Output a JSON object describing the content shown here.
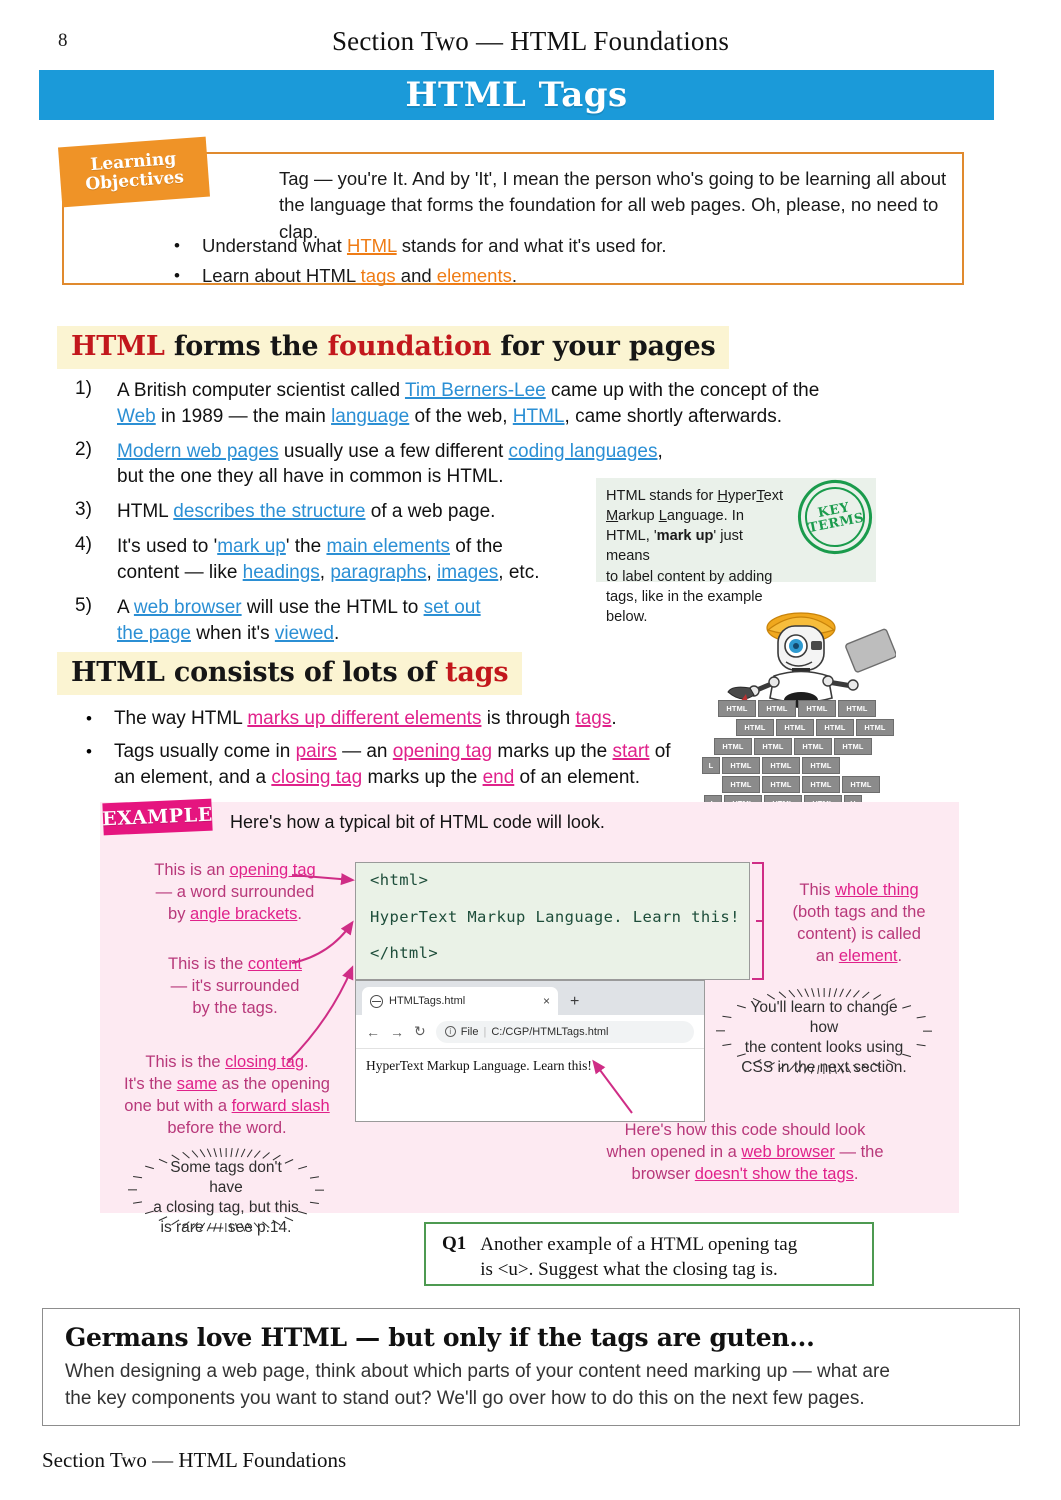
{
  "page": {
    "number": "8",
    "running_head": "Section Two — HTML Foundations",
    "title": "HTML Tags",
    "footer": "Section Two — HTML Foundations",
    "accent_blue": "#1b9ad9",
    "accent_orange": "#ef9327",
    "accent_pink": "#e5157f",
    "accent_green": "#1a9b4c",
    "heading_highlight": "#fbf4d2"
  },
  "learning_objectives": {
    "tab_line1": "Learning",
    "tab_line2": "Objectives",
    "intro_line1": "Tag — you're It.  And by 'It', I mean the person who's going to be learning all about",
    "intro_line2": "the language that forms the foundation for all web pages.  Oh, please, no need to clap.",
    "bullets": [
      {
        "pre": "Understand what ",
        "link": "HTML",
        "post": " stands for and what it's used for."
      },
      {
        "pre": "Learn about HTML ",
        "link": "tags",
        "mid": " and ",
        "link2": "elements",
        "post": "."
      }
    ]
  },
  "section1": {
    "heading_parts": [
      "HTML",
      " forms the ",
      "foundation",
      " for your pages"
    ],
    "items": [
      {
        "num": "1)",
        "line1_a": "A British computer scientist called ",
        "link1": "Tim Berners-Lee",
        "line1_b": " came up with the concept of the",
        "line2_a": "",
        "link2": "Web",
        "line2_b": " in 1989 — the main ",
        "link3": "language",
        "line2_c": " of the web, ",
        "link4": "HTML",
        "line2_d": ", came shortly afterwards."
      },
      {
        "num": "2)",
        "link1": "Modern web pages",
        "line1_b": " usually use a few different ",
        "link2": "coding languages",
        "line1_c": ",",
        "line2": "but the one they all have in common is HTML."
      },
      {
        "num": "3)",
        "line1_a": "HTML ",
        "link1": "describes the structure",
        "line1_b": " of a web page."
      },
      {
        "num": "4)",
        "line1_a": "It's used to '",
        "link1": "mark up",
        "line1_b": "' the ",
        "link2": "main elements",
        "line1_c": " of the",
        "line2_a": "content — like ",
        "link3": "headings",
        "line2_b": ", ",
        "link4": "paragraphs",
        "line2_c": ", ",
        "link5": "images",
        "line2_d": ", etc."
      },
      {
        "num": "5)",
        "line1_a": "A ",
        "link1": "web browser",
        "line1_b": " will use the HTML to ",
        "link2": "set out",
        "line2_a": "",
        "link3": "the page",
        "line2_b": " when it's ",
        "link4": "viewed",
        "line2_c": "."
      }
    ]
  },
  "key_terms": {
    "stamp_line1": "KEY",
    "stamp_line2": "TERMS",
    "text_line1_a": "HTML stands for ",
    "text_line1_u1": "H",
    "text_line1_b": "yper",
    "text_line1_u2": "T",
    "text_line1_c": "ext",
    "text_line2_u1": "M",
    "text_line2_a": "arkup ",
    "text_line2_u2": "L",
    "text_line2_b": "anguage.  In",
    "text_line3_a": "HTML, '",
    "text_line3_b": "mark up",
    "text_line3_c": "' just means",
    "text_line4": "to label content by adding",
    "text_line5": "tags, like in the example below."
  },
  "robot": {
    "brick_label": "HTML",
    "brick_rows": [
      [
        "HTML",
        "HTML",
        "HTML",
        "HTML"
      ],
      [
        "HTML",
        "HTML",
        "HTML",
        "HTML"
      ],
      [
        "HTML",
        "HTML",
        "HTML",
        "HTML"
      ],
      [
        "HTML",
        "HTML",
        "HTML",
        "HTML"
      ],
      [
        "HTML",
        "HTML",
        "HTML",
        "HTML"
      ],
      [
        "HTML",
        "HTML",
        "HTML",
        "HTML"
      ]
    ]
  },
  "section2": {
    "heading_parts": [
      "HTML consists of lots of ",
      "tags"
    ],
    "bullets": [
      {
        "a": "The way HTML ",
        "l1": "marks up different elements",
        "b": " is through ",
        "l2": "tags",
        "c": "."
      },
      {
        "a": "Tags usually come in ",
        "l1": "pairs",
        "b": " — an ",
        "l2": "opening tag",
        "c": " marks up the ",
        "l3": "start",
        "d": " of",
        "line2_a": "an element, and a ",
        "l4": "closing tag",
        "line2_b": " marks up the ",
        "l5": "end",
        "line2_c": " of an element."
      }
    ]
  },
  "example": {
    "stamp": "EXAMPLE",
    "intro": "Here's how a typical bit of HTML code will look.",
    "code_lines": [
      "<html>",
      "HyperText Markup Language. Learn this!",
      "</html>"
    ],
    "annotations": {
      "opening": {
        "l1_a": "This is an ",
        "l1_u": "opening tag",
        "l2": "— a word surrounded",
        "l3_a": "by ",
        "l3_u": "angle brackets",
        "l3_b": "."
      },
      "content": {
        "l1_a": "This is the ",
        "l1_u": "content",
        "l2": "— it's surrounded",
        "l3": "by the tags."
      },
      "closing": {
        "l1_a": "This is the ",
        "l1_u": "closing tag",
        "l1_b": ".",
        "l2_a": "It's the ",
        "l2_u": "same",
        "l2_b": " as the opening",
        "l3_a": "one but with a ",
        "l3_u": "forward slash",
        "l4": "before the word."
      },
      "whole": {
        "l1_a": "This ",
        "l1_u": "whole thing",
        "l2": "(both tags and the",
        "l3": "content) is called",
        "l4_a": "an ",
        "l4_u": "element",
        "l4_b": "."
      },
      "browser": {
        "l1": "Here's how this code should look",
        "l2_a": "when opened in a ",
        "l2_u": "web browser",
        "l2_b": " — the",
        "l3_a": "browser ",
        "l3_u": "doesn't show the tags",
        "l3_b": "."
      }
    },
    "notes": {
      "css": [
        "You'll learn to change how",
        "the content looks using",
        "CSS in the next section."
      ],
      "rare": [
        "Some tags don't have",
        "a closing tag, but this",
        "is rare — see p.14."
      ]
    },
    "browser": {
      "tab_title": "HTMLTags.html",
      "close_label": "×",
      "new_tab_label": "+",
      "back_label": "←",
      "forward_label": "→",
      "reload_label": "↻",
      "info_label": "i",
      "url_scheme": "File",
      "url_sep": "|",
      "url": "C:/CGP/HTMLTags.html",
      "page_text": "HyperText Markup Language. Learn this!"
    }
  },
  "question": {
    "number": "Q1",
    "line1": "Another example of a HTML opening tag",
    "line2": "is <u>.  Suggest what the closing tag is."
  },
  "joke": {
    "heading": "Germans love HTML — but only if the tags are guten...",
    "line1": "When designing a web page, think about which parts of your content need marking up — what are",
    "line2": "the key components you want to stand out?  We'll go over how to do this on the next few pages."
  }
}
